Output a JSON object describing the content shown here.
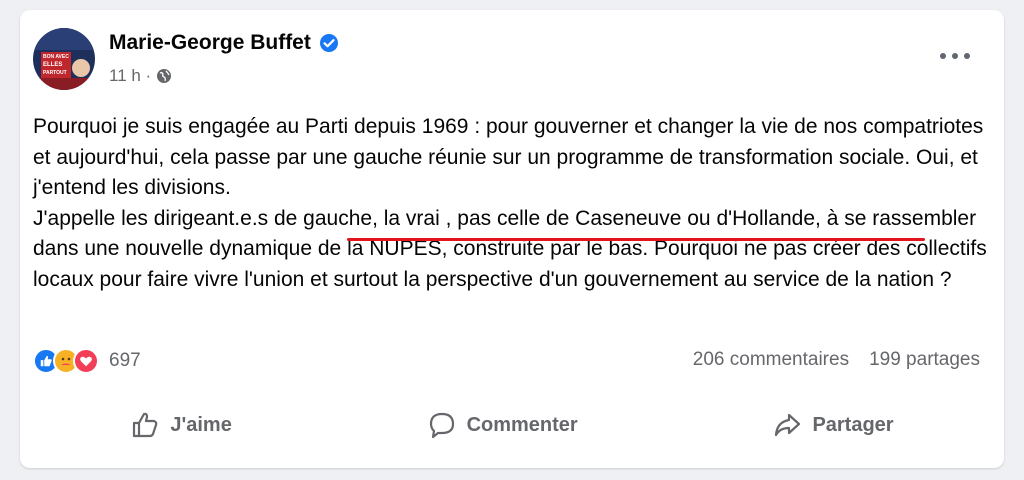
{
  "post": {
    "author": "Marie-George Buffet",
    "time": "11 h ·",
    "paragraph_1": "Pourquoi je suis engagée au Parti depuis 1969 : pour gouverner et changer la vie de nos compatriotes et aujourd'hui, cela passe par une gauche réunie sur un programme de transformation sociale. Oui, et j'entend les divisions.",
    "paragraph_2": "J'appelle les dirigeant.e.s de gauche,  la vrai , pas celle de Caseneuve ou d'Hollande,  à se rassembler dans une nouvelle dynamique de la NUPES, construite par le bas. Pourquoi ne pas créer des collectifs locaux pour faire vivre l'union et surtout la perspective d'un gouvernement au service de la nation ?",
    "avatar_text": [
      "BON AVEC",
      "ELLES",
      "PARTOUT"
    ]
  },
  "reactions": {
    "count": "697",
    "icons": [
      "like-icon",
      "care-icon",
      "love-icon"
    ],
    "colors": {
      "like": "#1877f2",
      "care": "#f7b125",
      "love": "#f33e58"
    }
  },
  "stats": {
    "comments": "206 commentaires",
    "shares": "199 partages"
  },
  "actions": {
    "like": "J'aime",
    "comment": "Commenter",
    "share": "Partager"
  },
  "colors": {
    "underline": "#e3141c",
    "verified": "#1877f2",
    "secondary_text": "#65676b"
  }
}
